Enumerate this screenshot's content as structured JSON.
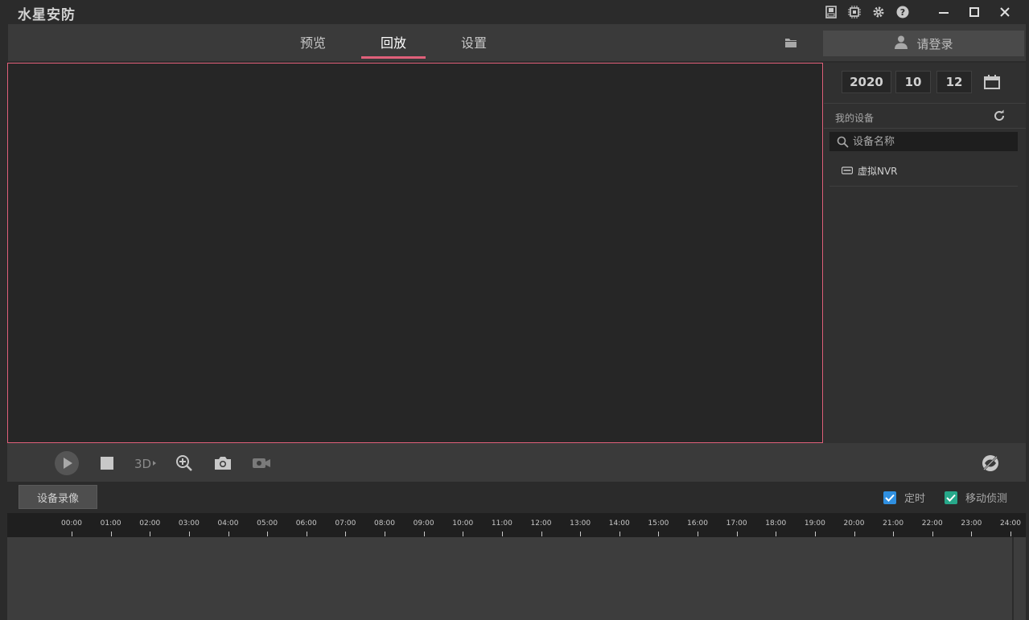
{
  "app": {
    "title": "水星安防"
  },
  "titlebar_icons": [
    "disk-icon",
    "chip-icon",
    "gear-icon",
    "help-icon"
  ],
  "nav": {
    "tabs": [
      {
        "label": "预览",
        "active": false
      },
      {
        "label": "回放",
        "active": true
      },
      {
        "label": "设置",
        "active": false
      }
    ],
    "login_label": "请登录"
  },
  "date": {
    "year": "2020",
    "month": "10",
    "day": "12"
  },
  "devices": {
    "title": "我的设备",
    "search_placeholder": "设备名称",
    "items": [
      {
        "label": "虚拟NVR"
      }
    ]
  },
  "record": {
    "button_label": "设备录像",
    "filters": [
      {
        "label": "定时",
        "checked": true,
        "color": "#2f8fe0"
      },
      {
        "label": "移动侦测",
        "checked": true,
        "color": "#27a88a"
      }
    ]
  },
  "timeline": {
    "hours": [
      "00:00",
      "01:00",
      "02:00",
      "03:00",
      "04:00",
      "05:00",
      "06:00",
      "07:00",
      "08:00",
      "09:00",
      "10:00",
      "11:00",
      "12:00",
      "13:00",
      "14:00",
      "15:00",
      "16:00",
      "17:00",
      "18:00",
      "19:00",
      "20:00",
      "21:00",
      "22:00",
      "23:00",
      "24:00"
    ]
  },
  "colors": {
    "accent": "#e0607a",
    "background": "#2b2b2b",
    "panel": "#3a3a3a"
  }
}
